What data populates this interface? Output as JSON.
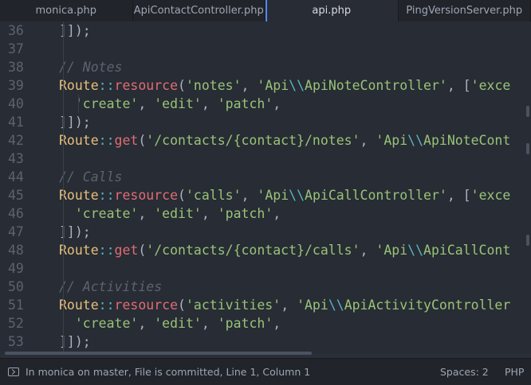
{
  "tabs": [
    {
      "label": "monica.php",
      "active": false
    },
    {
      "label": "ApiContactController.php",
      "active": false
    },
    {
      "label": "api.php",
      "active": true
    },
    {
      "label": "PingVersionServer.php",
      "active": false
    }
  ],
  "editor": {
    "lines": [
      {
        "no": "36",
        "tokens": [
          [
            "p",
            "]]);"
          ]
        ]
      },
      {
        "no": "37",
        "tokens": []
      },
      {
        "no": "38",
        "tokens": [
          [
            "c",
            "// Notes"
          ]
        ]
      },
      {
        "no": "39",
        "tokens": [
          [
            "k",
            "Route"
          ],
          [
            "o",
            "::"
          ],
          [
            "f",
            "resource"
          ],
          [
            "p",
            "("
          ],
          [
            "s",
            "'notes'"
          ],
          [
            "p",
            ", "
          ],
          [
            "s",
            "'Api"
          ],
          [
            "e",
            "\\\\"
          ],
          [
            "s",
            "ApiNoteController'"
          ],
          [
            "p",
            ", ["
          ],
          [
            "s",
            "'exce"
          ]
        ]
      },
      {
        "no": "40",
        "tokens": [
          [
            "p",
            "  "
          ],
          [
            "s",
            "'create'"
          ],
          [
            "p",
            ", "
          ],
          [
            "s",
            "'edit'"
          ],
          [
            "p",
            ", "
          ],
          [
            "s",
            "'patch'"
          ],
          [
            "p",
            ","
          ]
        ]
      },
      {
        "no": "41",
        "tokens": [
          [
            "p",
            "]]);"
          ]
        ]
      },
      {
        "no": "42",
        "tokens": [
          [
            "k",
            "Route"
          ],
          [
            "o",
            "::"
          ],
          [
            "f",
            "get"
          ],
          [
            "p",
            "("
          ],
          [
            "s",
            "'/contacts/{contact}/notes'"
          ],
          [
            "p",
            ", "
          ],
          [
            "s",
            "'Api"
          ],
          [
            "e",
            "\\\\"
          ],
          [
            "s",
            "ApiNoteCont"
          ]
        ]
      },
      {
        "no": "43",
        "tokens": []
      },
      {
        "no": "44",
        "tokens": [
          [
            "c",
            "// Calls"
          ]
        ]
      },
      {
        "no": "45",
        "tokens": [
          [
            "k",
            "Route"
          ],
          [
            "o",
            "::"
          ],
          [
            "f",
            "resource"
          ],
          [
            "p",
            "("
          ],
          [
            "s",
            "'calls'"
          ],
          [
            "p",
            ", "
          ],
          [
            "s",
            "'Api"
          ],
          [
            "e",
            "\\\\"
          ],
          [
            "s",
            "ApiCallController'"
          ],
          [
            "p",
            ", ["
          ],
          [
            "s",
            "'exce"
          ]
        ]
      },
      {
        "no": "46",
        "tokens": [
          [
            "p",
            "  "
          ],
          [
            "s",
            "'create'"
          ],
          [
            "p",
            ", "
          ],
          [
            "s",
            "'edit'"
          ],
          [
            "p",
            ", "
          ],
          [
            "s",
            "'patch'"
          ],
          [
            "p",
            ","
          ]
        ]
      },
      {
        "no": "47",
        "tokens": [
          [
            "p",
            "]]);"
          ]
        ]
      },
      {
        "no": "48",
        "tokens": [
          [
            "k",
            "Route"
          ],
          [
            "o",
            "::"
          ],
          [
            "f",
            "get"
          ],
          [
            "p",
            "("
          ],
          [
            "s",
            "'/contacts/{contact}/calls'"
          ],
          [
            "p",
            ", "
          ],
          [
            "s",
            "'Api"
          ],
          [
            "e",
            "\\\\"
          ],
          [
            "s",
            "ApiCallCont"
          ]
        ]
      },
      {
        "no": "49",
        "tokens": []
      },
      {
        "no": "50",
        "tokens": [
          [
            "c",
            "// Activities"
          ]
        ]
      },
      {
        "no": "51",
        "tokens": [
          [
            "k",
            "Route"
          ],
          [
            "o",
            "::"
          ],
          [
            "f",
            "resource"
          ],
          [
            "p",
            "("
          ],
          [
            "s",
            "'activities'"
          ],
          [
            "p",
            ", "
          ],
          [
            "s",
            "'Api"
          ],
          [
            "e",
            "\\\\"
          ],
          [
            "s",
            "ApiActivityController"
          ]
        ]
      },
      {
        "no": "52",
        "tokens": [
          [
            "p",
            "  "
          ],
          [
            "s",
            "'create'"
          ],
          [
            "p",
            ", "
          ],
          [
            "s",
            "'edit'"
          ],
          [
            "p",
            ", "
          ],
          [
            "s",
            "'patch'"
          ],
          [
            "p",
            ","
          ]
        ]
      },
      {
        "no": "53",
        "tokens": [
          [
            "p",
            "]]);"
          ]
        ]
      }
    ]
  },
  "status": {
    "left_text": "In monica on master, File is committed, Line 1, Column 1",
    "spaces": "Spaces: 2",
    "language": "PHP",
    "terminal_icon": "terminal-icon"
  },
  "colors": {
    "editor_bg": "#282c34",
    "accent": "#568af2",
    "class": "#e5c07b",
    "function": "#e06c75",
    "string": "#98c379",
    "operator": "#56b6c2",
    "comment": "#5c6370"
  }
}
